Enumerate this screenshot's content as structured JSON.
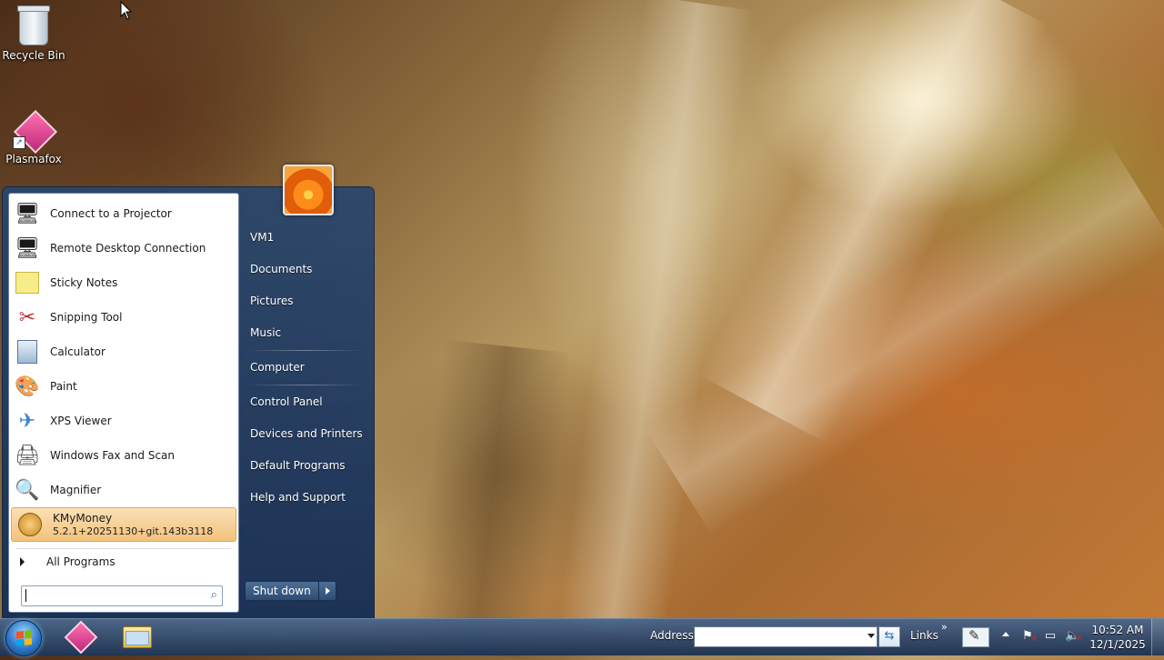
{
  "desktop": {
    "icons": [
      {
        "label": "Recycle Bin",
        "icon": "recycle-bin-icon"
      },
      {
        "label": "Plasmafox",
        "icon": "plasmafox-icon"
      }
    ]
  },
  "start_menu": {
    "programs": [
      {
        "label": "Connect to a Projector",
        "icon": "projector-icon"
      },
      {
        "label": "Remote Desktop Connection",
        "icon": "remote-desktop-icon"
      },
      {
        "label": "Sticky Notes",
        "icon": "sticky-notes-icon"
      },
      {
        "label": "Snipping Tool",
        "icon": "snipping-tool-icon"
      },
      {
        "label": "Calculator",
        "icon": "calculator-icon"
      },
      {
        "label": "Paint",
        "icon": "paint-icon"
      },
      {
        "label": "XPS Viewer",
        "icon": "xps-viewer-icon"
      },
      {
        "label": "Windows Fax and Scan",
        "icon": "fax-scan-icon"
      },
      {
        "label": "Magnifier",
        "icon": "magnifier-icon"
      },
      {
        "label": "KMyMoney",
        "sublabel": "5.2.1+20251130+git.143b3118",
        "icon": "kmymoney-icon",
        "highlighted": true
      }
    ],
    "all_programs_label": "All Programs",
    "search": {
      "value": "",
      "placeholder": ""
    },
    "right_items": [
      {
        "label": "VM1"
      },
      {
        "label": "Documents"
      },
      {
        "label": "Pictures"
      },
      {
        "label": "Music"
      },
      {
        "label": "Computer"
      },
      {
        "label": "Control Panel"
      },
      {
        "label": "Devices and Printers"
      },
      {
        "label": "Default Programs"
      },
      {
        "label": "Help and Support"
      }
    ],
    "shutdown_label": "Shut down"
  },
  "taskbar": {
    "pinned": [
      {
        "icon": "plasmafox-icon"
      },
      {
        "icon": "file-explorer-icon"
      }
    ],
    "address_label": "Address",
    "address_value": "",
    "links_label": "Links",
    "links_chevron": "»",
    "clock": {
      "time": "10:52 AM",
      "date": "12/1/2025"
    }
  },
  "colors": {
    "highlight": "#f3c27c",
    "menu_blue": "#1f3d66"
  }
}
